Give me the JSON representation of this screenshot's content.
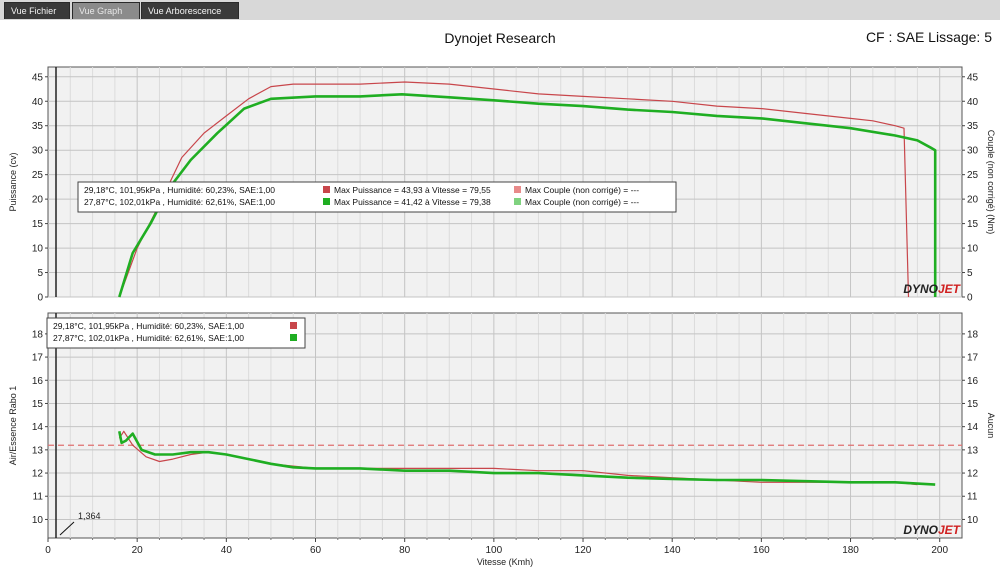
{
  "tabs": [
    {
      "label": "Vue Fichier",
      "active": false
    },
    {
      "label": "Vue Graph",
      "active": true
    },
    {
      "label": "Vue Arborescence",
      "active": false
    }
  ],
  "app_title": "Dynojet Research",
  "cf_label": "CF : SAE Lissage: 5",
  "logo_text": "DYNOJET",
  "colors": {
    "run1": "#c8464b",
    "run2": "#1fae22",
    "grid": "#c9c9c9",
    "afr_target": "#e07070"
  },
  "chart_data": [
    {
      "type": "line",
      "ylabel": "Puissance (cv)",
      "ylabel_right": "Couple (non corrigé) (Nm)",
      "xlim": [
        0,
        205
      ],
      "ylim": [
        0,
        47
      ],
      "y_ticks": [
        0,
        5,
        10,
        15,
        20,
        25,
        30,
        35,
        40,
        45
      ],
      "y_ticks_right": [
        0,
        5,
        10,
        15,
        20,
        25,
        30,
        35,
        40,
        45
      ],
      "x_ticks": [
        0,
        20,
        40,
        60,
        80,
        100,
        120,
        140,
        160,
        180,
        200
      ],
      "grid": true,
      "legend": [
        {
          "conditions": "29,18°C, 101,95kPa , Humidité: 60,23%, SAE:1,00",
          "max_power": "Max Puissance = 43,93 à Vitesse = 79,55",
          "max_couple": "Max Couple (non corrigé) = ---"
        },
        {
          "conditions": "27,87°C, 102,01kPa , Humidité: 62,61%, SAE:1,00",
          "max_power": "Max Puissance = 41,42 à Vitesse = 79,38",
          "max_couple": "Max Couple (non corrigé) = ---"
        }
      ],
      "series": [
        {
          "x": [
            16,
            20,
            25,
            30,
            35,
            40,
            45,
            50,
            55,
            60,
            70,
            80,
            90,
            100,
            110,
            120,
            130,
            140,
            150,
            160,
            170,
            180,
            185,
            190,
            192,
            193,
            193
          ],
          "y": [
            0,
            10,
            19,
            28.5,
            33.5,
            37,
            40.5,
            43,
            43.5,
            43.5,
            43.5,
            43.93,
            43.5,
            42.5,
            41.5,
            41,
            40.5,
            40,
            39,
            38.5,
            37.5,
            36.5,
            36,
            35,
            34.5,
            0,
            0
          ]
        },
        {
          "x": [
            16,
            19,
            23,
            27,
            32,
            38,
            44,
            50,
            60,
            70,
            79.38,
            90,
            100,
            110,
            120,
            130,
            140,
            150,
            160,
            170,
            180,
            190,
            195,
            198,
            199,
            199
          ],
          "y": [
            0,
            9,
            15,
            22,
            28,
            33.5,
            38.5,
            40.5,
            41,
            41,
            41.42,
            40.8,
            40.2,
            39.5,
            39,
            38.3,
            37.8,
            37,
            36.5,
            35.5,
            34.5,
            33,
            32,
            30.5,
            30,
            0
          ]
        }
      ]
    },
    {
      "type": "line",
      "ylabel": "Air/Essence Rabo 1",
      "ylabel_right": "Aucun",
      "xlabel": "Vitesse (Kmh)",
      "xlim": [
        0,
        205
      ],
      "ylim": [
        9.2,
        18.9
      ],
      "y_ticks": [
        10,
        11,
        12,
        13,
        14,
        15,
        16,
        17,
        18
      ],
      "y_ticks_right": [
        10,
        11,
        12,
        13,
        14,
        15,
        16,
        17,
        18
      ],
      "x_ticks": [
        0,
        20,
        40,
        60,
        80,
        100,
        120,
        140,
        160,
        180,
        200
      ],
      "grid": true,
      "target_line": 13.2,
      "cursor_value": "1,364",
      "legend": [
        {
          "conditions": "29,18°C, 101,95kPa , Humidité: 60,23%, SAE:1,00"
        },
        {
          "conditions": "27,87°C, 102,01kPa , Humidité: 62,61%, SAE:1,00"
        }
      ],
      "series": [
        {
          "x": [
            16,
            17,
            19,
            22,
            25,
            28,
            32,
            36,
            40,
            45,
            50,
            60,
            70,
            80,
            90,
            100,
            110,
            120,
            130,
            140,
            150,
            160,
            170,
            180,
            190,
            195
          ],
          "y": [
            13.5,
            13.8,
            13.2,
            12.7,
            12.5,
            12.6,
            12.8,
            12.9,
            12.8,
            12.6,
            12.4,
            12.2,
            12.2,
            12.2,
            12.2,
            12.2,
            12.1,
            12.1,
            11.9,
            11.8,
            11.7,
            11.6,
            11.6,
            11.6,
            11.6,
            11.5
          ]
        },
        {
          "x": [
            16,
            16.5,
            17.5,
            19,
            21,
            24,
            28,
            32,
            36,
            40,
            45,
            50,
            55,
            60,
            70,
            80,
            90,
            100,
            110,
            120,
            130,
            140,
            150,
            160,
            170,
            180,
            190,
            199
          ],
          "y": [
            13.8,
            13.3,
            13.4,
            13.7,
            13.0,
            12.8,
            12.8,
            12.9,
            12.9,
            12.8,
            12.6,
            12.4,
            12.25,
            12.2,
            12.2,
            12.1,
            12.1,
            12.0,
            12.0,
            11.9,
            11.8,
            11.75,
            11.7,
            11.7,
            11.65,
            11.6,
            11.6,
            11.5
          ]
        }
      ]
    }
  ]
}
